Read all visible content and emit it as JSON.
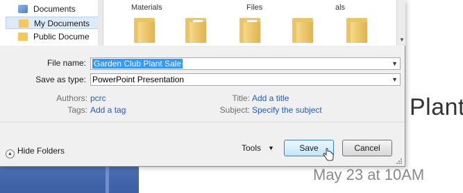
{
  "slide": {
    "title_fragment": "Plant",
    "date": "May 23 at 10AM"
  },
  "nav": {
    "items": [
      {
        "label": "Documents",
        "icon": "documents-icon",
        "selected": false
      },
      {
        "label": "My Documents",
        "icon": "folder-icon",
        "selected": true
      },
      {
        "label": "Public Docume",
        "icon": "folder-icon",
        "selected": false
      }
    ]
  },
  "files": {
    "labels": [
      "Materials",
      "Files",
      "als"
    ],
    "folders": [
      "folder",
      "folder",
      "folder",
      "folder",
      "folder"
    ]
  },
  "form": {
    "file_name_label": "File name:",
    "file_name_value": "Garden Club Plant Sale",
    "save_type_label": "Save as type:",
    "save_type_value": "PowerPoint Presentation",
    "authors_label": "Authors:",
    "authors_value": "pcrc",
    "tags_label": "Tags:",
    "tags_value": "Add a tag",
    "title_label": "Title:",
    "title_value": "Add a title",
    "subject_label": "Subject:",
    "subject_value": "Specify the subject"
  },
  "footer": {
    "hide_folders_label": "Hide Folders",
    "tools_label": "Tools",
    "save_label": "Save",
    "cancel_label": "Cancel"
  },
  "colors": {
    "selection": "#3399ff",
    "link": "#1f5fb8",
    "dialog_bg": "#f0f0f0",
    "slide_bar": "#4b6fb3"
  }
}
